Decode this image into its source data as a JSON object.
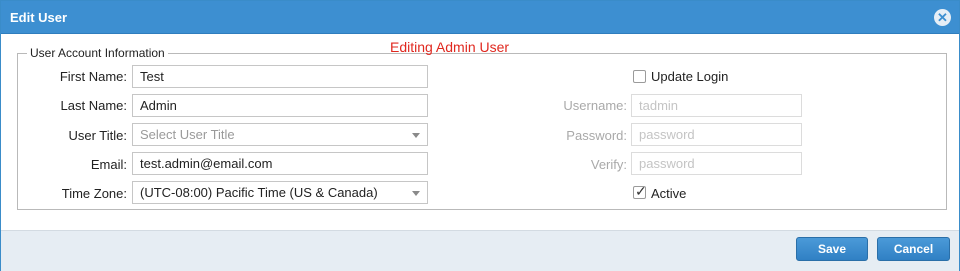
{
  "dialog": {
    "title": "Edit User",
    "close_icon": "close-circle-icon",
    "editing_notice": "Editing Admin User"
  },
  "account": {
    "legend": "User Account Information",
    "first_name": {
      "label": "First Name:",
      "value": "Test"
    },
    "last_name": {
      "label": "Last Name:",
      "value": "Admin"
    },
    "user_title": {
      "label": "User Title:",
      "placeholder": "Select User Title"
    },
    "email": {
      "label": "Email:",
      "value": "test.admin@email.com"
    },
    "time_zone": {
      "label": "Time Zone:",
      "value": "(UTC-08:00) Pacific Time (US & Canada)"
    }
  },
  "login": {
    "update_login": {
      "label": "Update Login",
      "checked": false
    },
    "username": {
      "label": "Username:",
      "placeholder": "tadmin"
    },
    "password": {
      "label": "Password:",
      "placeholder": "password"
    },
    "verify": {
      "label": "Verify:",
      "placeholder": "password"
    },
    "active": {
      "label": "Active",
      "checked": true
    }
  },
  "footer": {
    "save_label": "Save",
    "cancel_label": "Cancel"
  },
  "colors": {
    "titlebar": "#3d8fd1",
    "notice": "#e0281f",
    "button": "#3080c4",
    "footer_bg": "#e6edf3"
  }
}
